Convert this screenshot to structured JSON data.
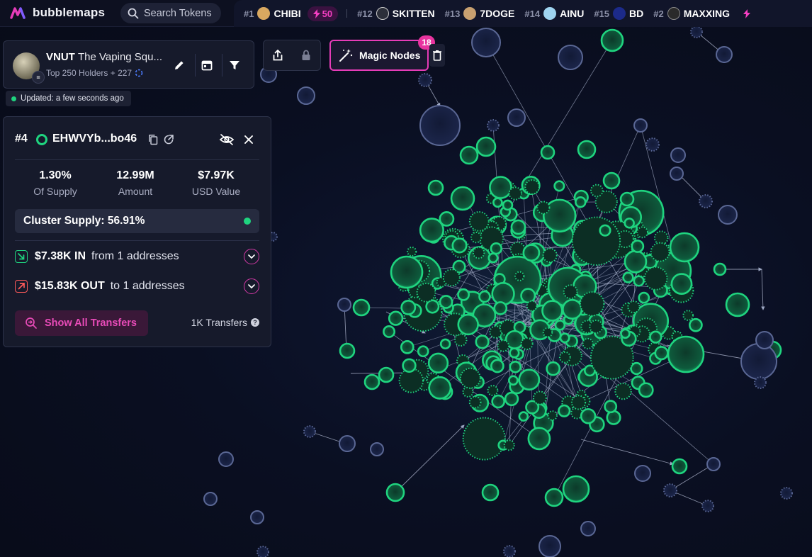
{
  "app": {
    "name": "bubblemaps",
    "brand_color": "#e63cb8"
  },
  "search": {
    "placeholder": "Search Tokens"
  },
  "ticker": [
    {
      "rank": "#1",
      "name": "CHIBI",
      "boost": "50"
    },
    {
      "rank": "#12",
      "name": "SKITTEN"
    },
    {
      "rank": "#13",
      "name": "7DOGE"
    },
    {
      "rank": "#14",
      "name": "AINU"
    },
    {
      "rank": "#15",
      "name": "BD"
    },
    {
      "rank": "#2",
      "name": "MAXXING"
    }
  ],
  "token": {
    "symbol": "VNUT",
    "name": "The Vaping Squ...",
    "subtitle": "Top 250 Holders + 227",
    "updated": "Updated: a few seconds ago"
  },
  "magic_nodes": {
    "label": "Magic Nodes",
    "count": "18"
  },
  "wallet": {
    "rank": "#4",
    "address": "EHWVYb...bo46",
    "stats": [
      {
        "value": "1.30%",
        "label": "Of Supply"
      },
      {
        "value": "12.99M",
        "label": "Amount"
      },
      {
        "value": "$7.97K",
        "label": "USD Value"
      }
    ],
    "cluster_supply": "Cluster Supply: 56.91%",
    "in": {
      "amount": "$7.38K IN",
      "desc": "from 1 addresses"
    },
    "out": {
      "amount": "$15.83K OUT",
      "desc": "to 1 addresses"
    },
    "show_all_label": "Show All Transfers",
    "transfers_label": "1K Transfers"
  },
  "colors": {
    "holder_green": "#1fd47f",
    "inactive_node": "#2a3358",
    "in_green": "#1fd47f",
    "out_red": "#ff5a5a",
    "accent_pink": "#e63cb8"
  }
}
